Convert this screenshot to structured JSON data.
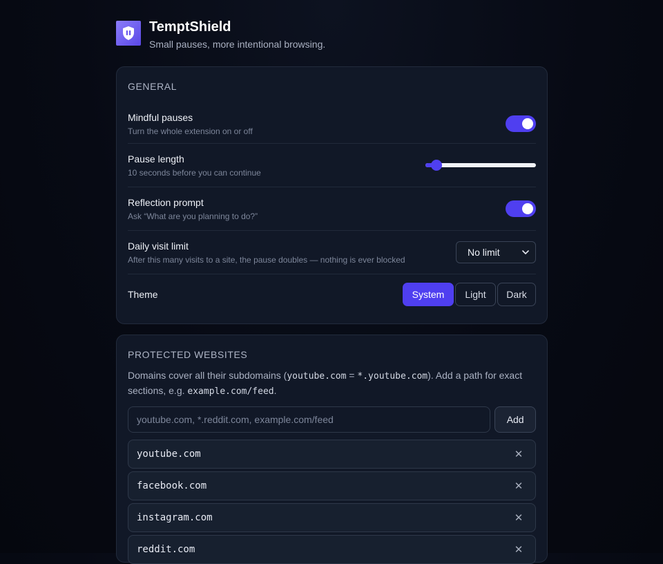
{
  "app": {
    "title": "TemptShield",
    "subtitle": "Small pauses, more intentional browsing.",
    "logo_icon": "shield-pause-icon",
    "accent": "#4f3ff0"
  },
  "general": {
    "heading": "GENERAL",
    "mindful": {
      "label": "Mindful pauses",
      "desc": "Turn the whole extension on or off",
      "enabled": true
    },
    "pause": {
      "label": "Pause length",
      "desc": "10 seconds before you can continue",
      "value_fraction": 0.1
    },
    "reflection": {
      "label": "Reflection prompt",
      "desc": "Ask “What are you planning to do?”",
      "enabled": true
    },
    "daily": {
      "label": "Daily visit limit",
      "desc": "After this many visits to a site, the pause doubles — nothing is ever blocked",
      "selected": "No limit"
    },
    "theme": {
      "label": "Theme",
      "options": [
        "System",
        "Light",
        "Dark"
      ],
      "selected": "System"
    }
  },
  "sites": {
    "heading": "PROTECTED WEBSITES",
    "help_1": "Domains cover all their subdomains (",
    "help_code_1": "youtube.com",
    "help_eq": " = ",
    "help_code_2": "*.youtube.com",
    "help_2": "). Add a path for exact sections, e.g. ",
    "help_code_3": "example.com/feed",
    "help_3": ".",
    "input_placeholder": "youtube.com, *.reddit.com, example.com/feed",
    "add_label": "Add",
    "items": [
      "youtube.com",
      "facebook.com",
      "instagram.com",
      "reddit.com"
    ],
    "remove_glyph": "✕"
  }
}
